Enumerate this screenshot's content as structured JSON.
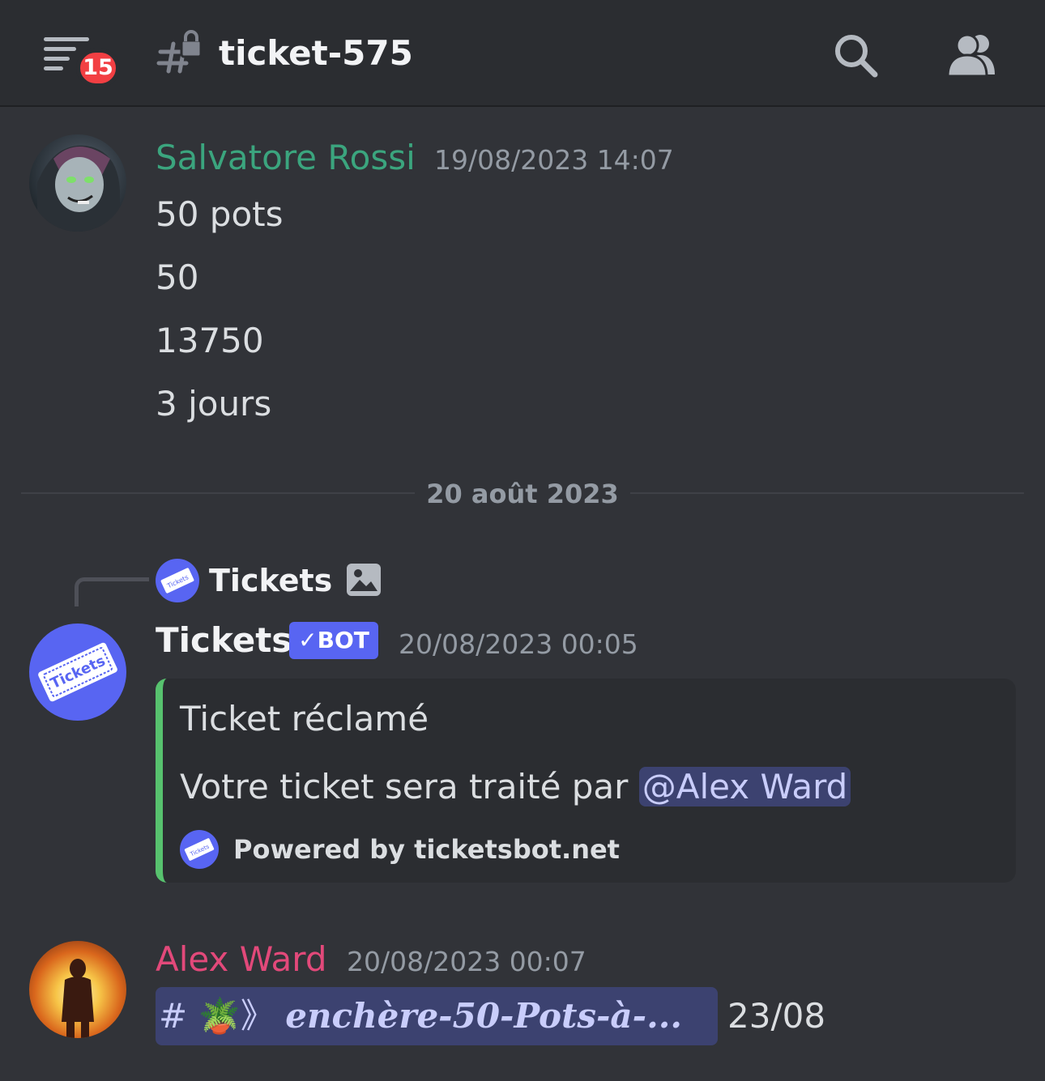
{
  "header": {
    "unread_count": "15",
    "channel_name": "ticket-575"
  },
  "divider": {
    "date": "20 août 2023"
  },
  "messages": [
    {
      "author": "Salvatore Rossi",
      "author_color": "#3ba57e",
      "timestamp": "19/08/2023 14:07",
      "lines": [
        "50 pots",
        "50",
        "13750",
        "3 jours"
      ]
    },
    {
      "reply": {
        "author": "Tickets"
      },
      "author": "Tickets",
      "author_color": "#f2f3f5",
      "bot_badge": "BOT",
      "timestamp": "20/08/2023 00:05",
      "embed": {
        "accent_color": "#57c26e",
        "title": "Ticket réclamé",
        "description_prefix": "Votre ticket sera traité par ",
        "mention": "@Alex Ward",
        "footer": "Powered by ticketsbot.net"
      }
    },
    {
      "author": "Alex Ward",
      "author_color": "#e2497a",
      "timestamp": "20/08/2023 00:07",
      "channel_mention": {
        "hash": "#",
        "emoji": "🪴",
        "arrow": "》",
        "name": "enchère-50-Pots-à-..."
      },
      "trailing_text": "23/08"
    }
  ]
}
